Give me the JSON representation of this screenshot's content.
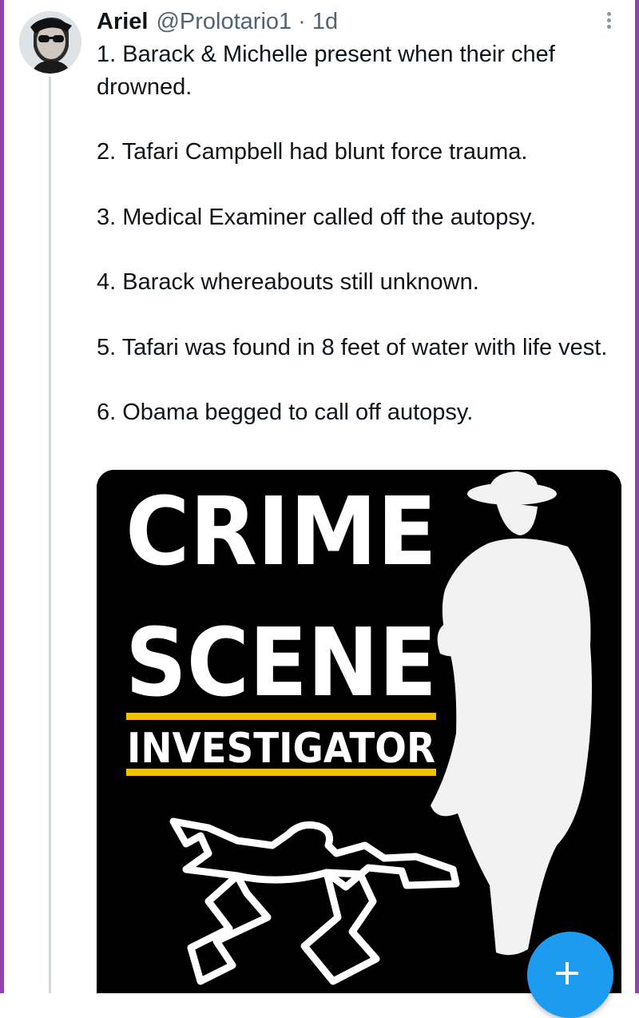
{
  "tweet": {
    "author_name": "Ariel",
    "author_handle": "@Prolotario1",
    "separator": "·",
    "timestamp": "1d",
    "paragraphs": [
      "1. Barack & Michelle present when their chef drowned.",
      "2. Tafari Campbell had blunt force trauma.",
      "3. Medical Examiner called off the autopsy.",
      "4. Barack whereabouts still unknown.",
      "5. Tafari was found in 8 feet of water with life vest.",
      "6. Obama begged to call off autopsy."
    ]
  },
  "media": {
    "line1": "CRIME",
    "line2": "SCENE",
    "line3": "INVESTIGATOR",
    "accent_color": "#f2c200"
  },
  "icons": {
    "more": "more-vertical-icon",
    "compose": "plus-icon"
  },
  "colors": {
    "accent": "#1d9bf0",
    "text": "#0f1419",
    "secondary": "#536471",
    "edge": "#8e44ad"
  }
}
